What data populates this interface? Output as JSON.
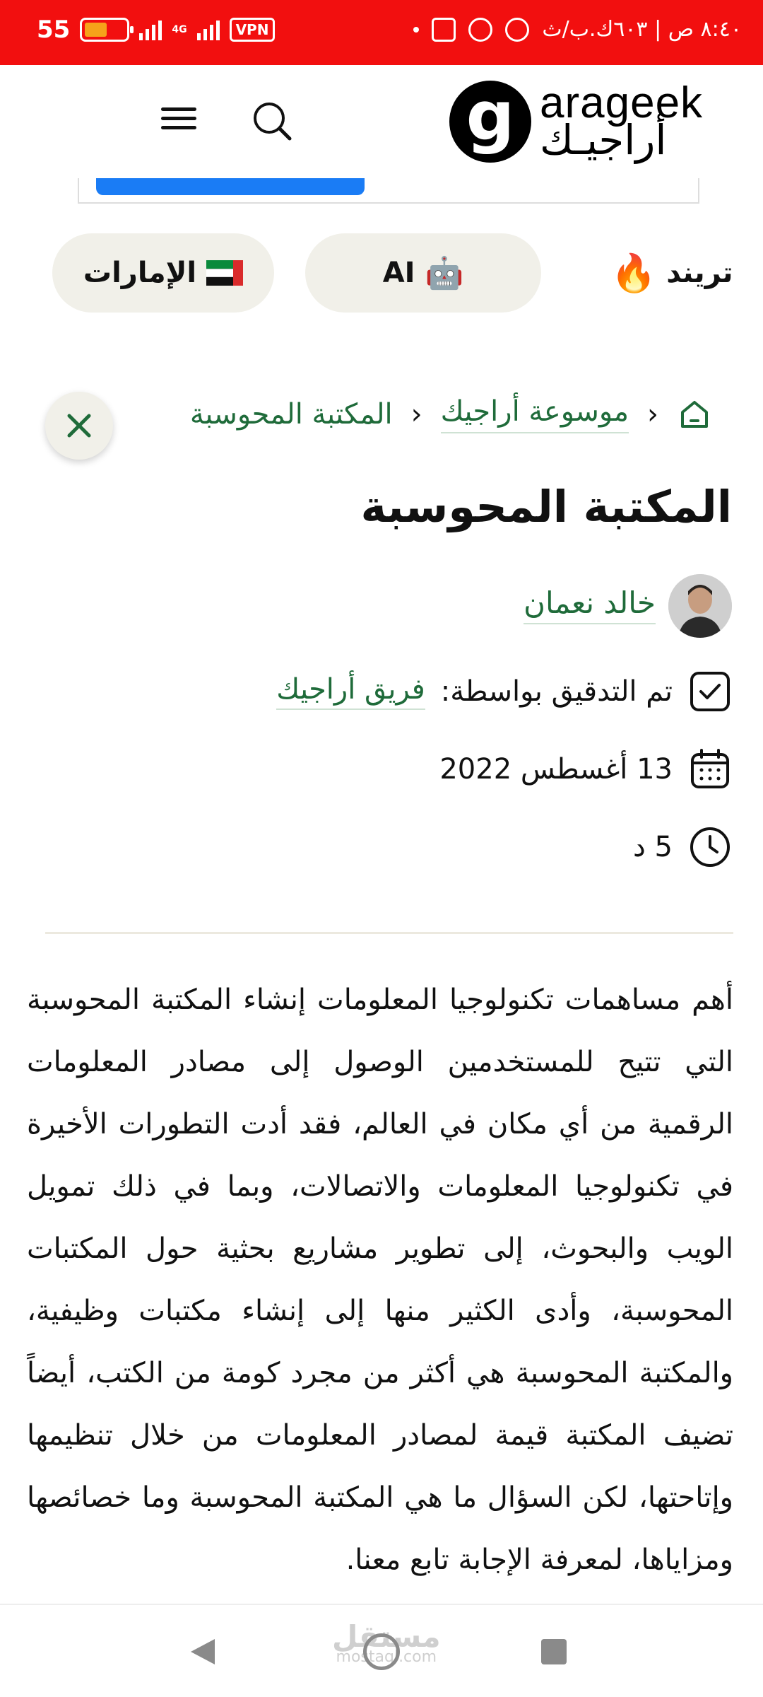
{
  "status_bar": {
    "time": "٨:٤٠ ص | ٦٠٣ك.ب/ث",
    "network": "4G",
    "vpn": "VPN",
    "battery": "55",
    "battery_level": 0.55,
    "battery_color": "#f6a21a",
    "background": "#f20f0f"
  },
  "header": {
    "logo_en": "arageek",
    "logo_ar": "أراجيـك",
    "logo_glyph": "g"
  },
  "chips": [
    {
      "label": "الإمارات",
      "icon": "uae-flag-icon"
    },
    {
      "label": "AI",
      "icon": "robot-icon",
      "emoji": "🤖"
    },
    {
      "label": "تريند",
      "icon": "fire-icon",
      "emoji": "🔥"
    }
  ],
  "breadcrumb": {
    "items": [
      "موسوعة أراجيك",
      "المكتبة المحوسبة"
    ],
    "separator": "‹"
  },
  "article": {
    "title": "المكتبة المحوسبة",
    "author": "خالد نعمان",
    "reviewed_label": "تم التدقيق بواسطة:",
    "reviewed_by": "فريق أراجيك",
    "date": "13 أغسطس 2022",
    "read_time": "5 د",
    "body": "أهم مساهمات تكنولوجيا المعلومات إنشاء المكتبة المحوسبة التي تتيح للمستخدمين الوصول إلى مصادر المعلومات الرقمية من أي مكان في العالم، فقد أدت التطورات الأخيرة في تكنولوجيا المعلومات والاتصالات، وبما في ذلك تمويل الويب والبحوث، إلى تطوير مشاريع بحثية حول المكتبات المحوسبة، وأدى الكثير منها إلى إنشاء مكتبات وظيفية، والمكتبة المحوسبة هي أكثر من مجرد كومة من الكتب، أيضاً تضيف المكتبة قيمة لمصادر المعلومات من خلال تنظيمها وإتاحتها، لكن السؤال ما هي المكتبة المحوسبة وما خصائصها ومزاياها، لمعرفة الإجابة تابع معنا."
  },
  "colors": {
    "accent_green": "#1f6b3a",
    "chip_bg": "#f1f0e9",
    "ad_blue": "#1a7cf5"
  },
  "watermark": {
    "ar": "مستقل",
    "en": "mostaql.com"
  }
}
